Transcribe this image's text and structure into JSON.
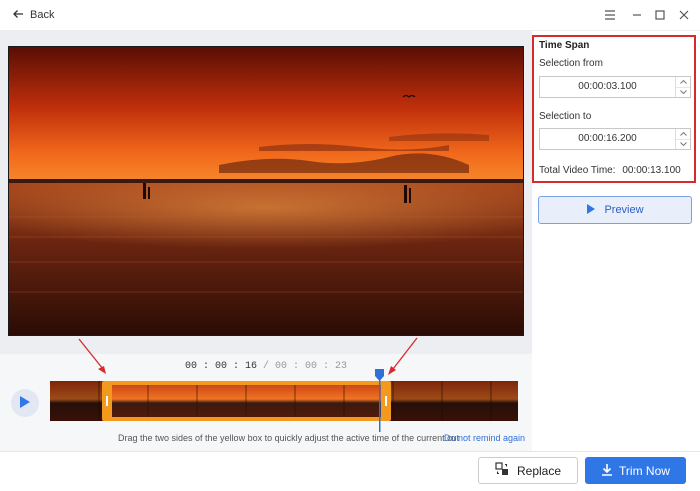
{
  "titlebar": {
    "back_label": "Back",
    "icons": [
      "arrow-left-icon",
      "menu-icon",
      "minimize-icon",
      "maximize-icon",
      "close-icon"
    ]
  },
  "player": {
    "current_time": "00 : 00 : 16",
    "separator": "/",
    "total_time": "00 : 00 : 23",
    "hint_text": "Drag the two sides of the yellow box to quickly adjust the active time of the current cut",
    "hint_link": "Do not remind again"
  },
  "time_span": {
    "title": "Time Span",
    "from_label": "Selection from",
    "from_value": "00:00:03.100",
    "to_label": "Selection to",
    "to_value": "00:00:16.200",
    "total_label": "Total Video Time:",
    "total_value": "00:00:13.100"
  },
  "buttons": {
    "preview": "Preview",
    "replace": "Replace",
    "trim_now": "Trim Now"
  },
  "colors": {
    "accent": "#2f77e6",
    "trim_box": "#f39a1e",
    "highlight": "#d62b2b",
    "playhead": "#2f6fd9"
  }
}
